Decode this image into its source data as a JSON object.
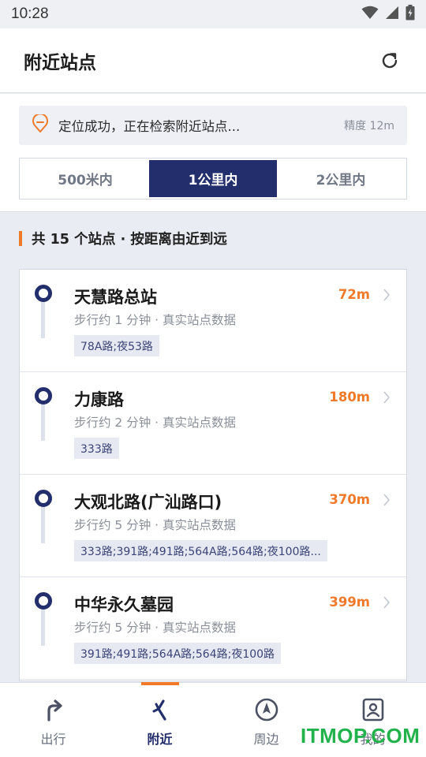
{
  "status_bar": {
    "time": "10:28"
  },
  "header": {
    "title": "附近站点"
  },
  "location": {
    "message": "定位成功，正在检索附近站点...",
    "accuracy": "精度 12m"
  },
  "range_options": [
    {
      "label": "500米内",
      "active": false
    },
    {
      "label": "1公里内",
      "active": true
    },
    {
      "label": "2公里内",
      "active": false
    }
  ],
  "section": {
    "title": "共 15 个站点 · 按距离由近到远"
  },
  "stops": [
    {
      "name": "天慧路总站",
      "walk": "步行约 1 分钟 · 真实站点数据",
      "routes": "78A路;夜53路",
      "distance": "72m"
    },
    {
      "name": "力康路",
      "walk": "步行约 2 分钟 · 真实站点数据",
      "routes": "333路",
      "distance": "180m"
    },
    {
      "name": "大观北路(广汕路口)",
      "walk": "步行约 5 分钟 · 真实站点数据",
      "routes": "333路;391路;491路;564A路;564路;夜100路...",
      "distance": "370m"
    },
    {
      "name": "中华永久墓园",
      "walk": "步行约 5 分钟 · 真实站点数据",
      "routes": "391路;491路;564A路;564路;夜100路",
      "distance": "399m"
    }
  ],
  "tabs": [
    {
      "label": "出行",
      "icon": "turn-right-icon",
      "active": false
    },
    {
      "label": "附近",
      "icon": "nearby-arrow-icon",
      "active": true
    },
    {
      "label": "周边",
      "icon": "compass-icon",
      "active": false
    },
    {
      "label": "我的",
      "icon": "profile-icon",
      "active": false
    }
  ],
  "watermark": "ITMOP.COM",
  "colors": {
    "primary": "#232f6d",
    "accent": "#f07a2a"
  }
}
